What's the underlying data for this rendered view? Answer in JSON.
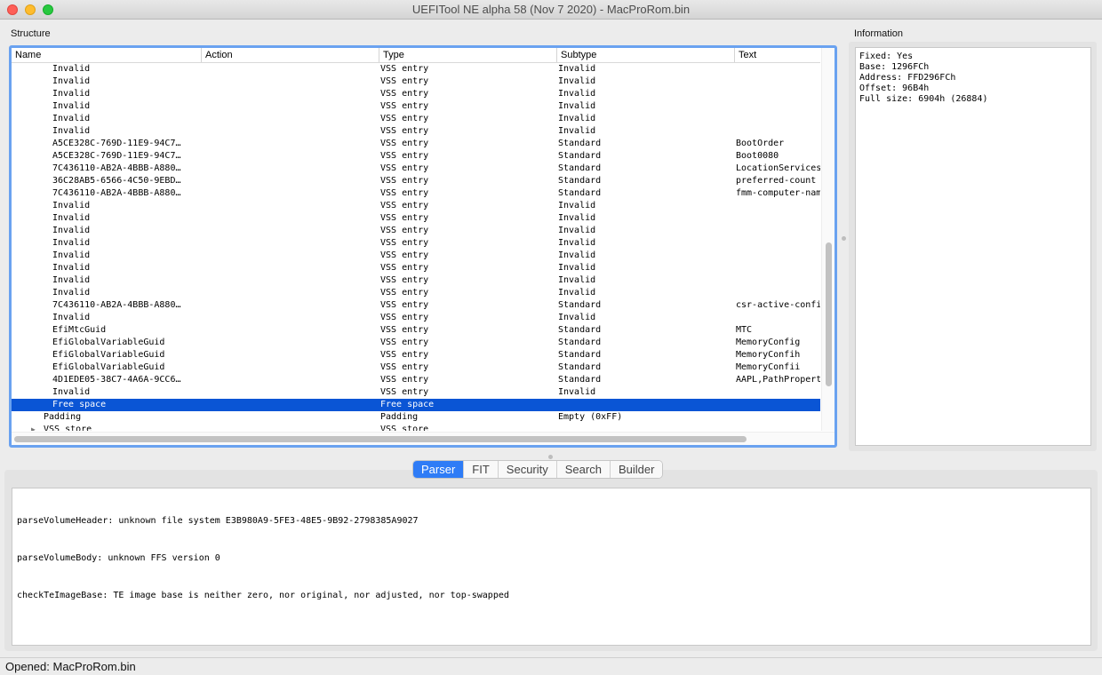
{
  "window": {
    "title": "UEFITool NE alpha 58 (Nov  7 2020) - MacProRom.bin"
  },
  "structure": {
    "label": "Structure",
    "columns": [
      "Name",
      "Action",
      "Type",
      "Subtype",
      "Text"
    ],
    "rows": [
      {
        "name": "Invalid",
        "action": "",
        "type": "VSS entry",
        "subtype": "Invalid",
        "text": "",
        "indent": 1
      },
      {
        "name": "Invalid",
        "action": "",
        "type": "VSS entry",
        "subtype": "Invalid",
        "text": "",
        "indent": 1
      },
      {
        "name": "Invalid",
        "action": "",
        "type": "VSS entry",
        "subtype": "Invalid",
        "text": "",
        "indent": 1
      },
      {
        "name": "Invalid",
        "action": "",
        "type": "VSS entry",
        "subtype": "Invalid",
        "text": "",
        "indent": 1
      },
      {
        "name": "Invalid",
        "action": "",
        "type": "VSS entry",
        "subtype": "Invalid",
        "text": "",
        "indent": 1
      },
      {
        "name": "Invalid",
        "action": "",
        "type": "VSS entry",
        "subtype": "Invalid",
        "text": "",
        "indent": 1
      },
      {
        "name": "A5CE328C-769D-11E9-94C7…",
        "action": "",
        "type": "VSS entry",
        "subtype": "Standard",
        "text": "BootOrder",
        "indent": 1
      },
      {
        "name": "A5CE328C-769D-11E9-94C7…",
        "action": "",
        "type": "VSS entry",
        "subtype": "Standard",
        "text": "Boot0080",
        "indent": 1
      },
      {
        "name": "7C436110-AB2A-4BBB-A880…",
        "action": "",
        "type": "VSS entry",
        "subtype": "Standard",
        "text": "LocationServicesEnabled",
        "indent": 1
      },
      {
        "name": "36C28AB5-6566-4C50-9EBD…",
        "action": "",
        "type": "VSS entry",
        "subtype": "Standard",
        "text": "preferred-count",
        "indent": 1
      },
      {
        "name": "7C436110-AB2A-4BBB-A880…",
        "action": "",
        "type": "VSS entry",
        "subtype": "Standard",
        "text": "fmm-computer-name",
        "indent": 1
      },
      {
        "name": "Invalid",
        "action": "",
        "type": "VSS entry",
        "subtype": "Invalid",
        "text": "",
        "indent": 1
      },
      {
        "name": "Invalid",
        "action": "",
        "type": "VSS entry",
        "subtype": "Invalid",
        "text": "",
        "indent": 1
      },
      {
        "name": "Invalid",
        "action": "",
        "type": "VSS entry",
        "subtype": "Invalid",
        "text": "",
        "indent": 1
      },
      {
        "name": "Invalid",
        "action": "",
        "type": "VSS entry",
        "subtype": "Invalid",
        "text": "",
        "indent": 1
      },
      {
        "name": "Invalid",
        "action": "",
        "type": "VSS entry",
        "subtype": "Invalid",
        "text": "",
        "indent": 1
      },
      {
        "name": "Invalid",
        "action": "",
        "type": "VSS entry",
        "subtype": "Invalid",
        "text": "",
        "indent": 1
      },
      {
        "name": "Invalid",
        "action": "",
        "type": "VSS entry",
        "subtype": "Invalid",
        "text": "",
        "indent": 1
      },
      {
        "name": "Invalid",
        "action": "",
        "type": "VSS entry",
        "subtype": "Invalid",
        "text": "",
        "indent": 1
      },
      {
        "name": "7C436110-AB2A-4BBB-A880…",
        "action": "",
        "type": "VSS entry",
        "subtype": "Standard",
        "text": "csr-active-config",
        "indent": 1
      },
      {
        "name": "Invalid",
        "action": "",
        "type": "VSS entry",
        "subtype": "Invalid",
        "text": "",
        "indent": 1
      },
      {
        "name": "EfiMtcGuid",
        "action": "",
        "type": "VSS entry",
        "subtype": "Standard",
        "text": "MTC",
        "indent": 1
      },
      {
        "name": "EfiGlobalVariableGuid",
        "action": "",
        "type": "VSS entry",
        "subtype": "Standard",
        "text": "MemoryConfig",
        "indent": 1
      },
      {
        "name": "EfiGlobalVariableGuid",
        "action": "",
        "type": "VSS entry",
        "subtype": "Standard",
        "text": "MemoryConfih",
        "indent": 1
      },
      {
        "name": "EfiGlobalVariableGuid",
        "action": "",
        "type": "VSS entry",
        "subtype": "Standard",
        "text": "MemoryConfii",
        "indent": 1
      },
      {
        "name": "4D1EDE05-38C7-4A6A-9CC6…",
        "action": "",
        "type": "VSS entry",
        "subtype": "Standard",
        "text": "AAPL,PathProperties",
        "indent": 1
      },
      {
        "name": "Invalid",
        "action": "",
        "type": "VSS entry",
        "subtype": "Invalid",
        "text": "",
        "indent": 1
      },
      {
        "name": "Free space",
        "action": "",
        "type": "Free space",
        "subtype": "",
        "text": "",
        "indent": 1,
        "selected": true
      },
      {
        "name": "Padding",
        "action": "",
        "type": "Padding",
        "subtype": "Empty (0xFF)",
        "text": "",
        "indent": 0
      },
      {
        "name": "VSS store",
        "action": "",
        "type": "VSS store",
        "subtype": "",
        "text": "",
        "indent": 0,
        "expander": "▶"
      }
    ]
  },
  "information": {
    "label": "Information",
    "text": "Fixed: Yes\nBase: 1296FCh\nAddress: FFD296FCh\nOffset: 96B4h\nFull size: 6904h (26884)"
  },
  "tabs": {
    "items": [
      {
        "label": "Parser",
        "active": true
      },
      {
        "label": "FIT"
      },
      {
        "label": "Security"
      },
      {
        "label": "Search"
      },
      {
        "label": "Builder"
      }
    ]
  },
  "log": {
    "lines": [
      "parseVolumeHeader: unknown file system E3B980A9-5FE3-48E5-9B92-2798385A9027",
      "parseVolumeBody: unknown FFS version 0",
      "checkTeImageBase: TE image base is neither zero, nor original, nor adjusted, nor top-swapped"
    ]
  },
  "status": {
    "text": "Opened: MacProRom.bin"
  },
  "colors": {
    "selection": "#0a55d5",
    "focus_ring": "#6aa2f0",
    "active_tab": "#2f7cf6"
  }
}
